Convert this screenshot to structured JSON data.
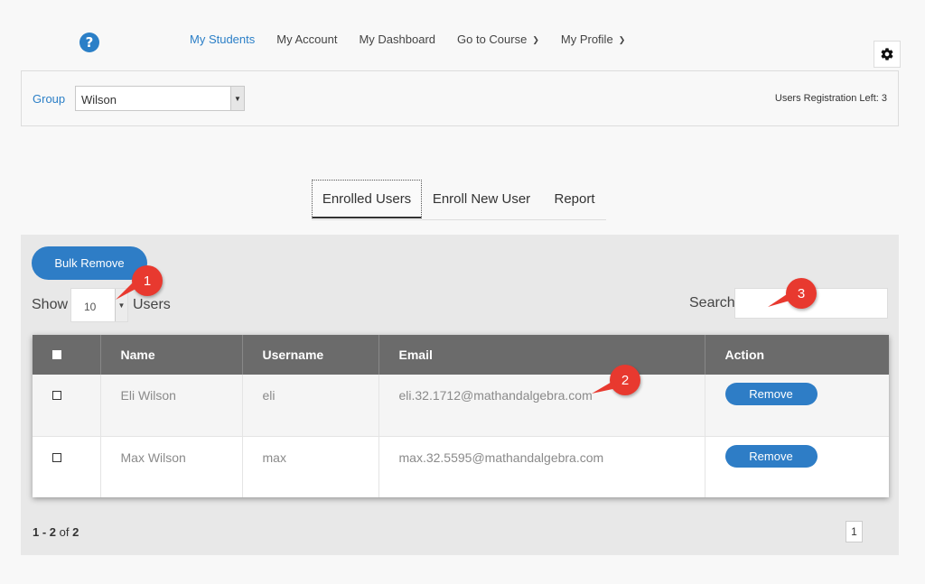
{
  "nav": {
    "items": [
      {
        "label": "My Students",
        "active": true,
        "dropdown": false
      },
      {
        "label": "My Account",
        "active": false,
        "dropdown": false
      },
      {
        "label": "My Dashboard",
        "active": false,
        "dropdown": false
      },
      {
        "label": "Go to Course",
        "active": false,
        "dropdown": true
      },
      {
        "label": "My Profile",
        "active": false,
        "dropdown": true
      }
    ],
    "help_icon": "?"
  },
  "group": {
    "label": "Group",
    "selected": "Wilson",
    "registration_left": "Users Registration Left: 3"
  },
  "tabs": {
    "enrolled": "Enrolled Users",
    "enroll_new": "Enroll New User",
    "report": "Report"
  },
  "controls": {
    "bulk_remove": "Bulk Remove",
    "show_label": "Show",
    "show_value": "10",
    "users_label": "Users",
    "search_label": "Search"
  },
  "table": {
    "headers": {
      "name": "Name",
      "username": "Username",
      "email": "Email",
      "action": "Action"
    },
    "rows": [
      {
        "name": "Eli Wilson",
        "username": "eli",
        "email": "eli.32.1712@mathandalgebra.com",
        "action": "Remove"
      },
      {
        "name": "Max Wilson",
        "username": "max",
        "email": "max.32.5595@mathandalgebra.com",
        "action": "Remove"
      }
    ]
  },
  "pagination": {
    "range": "1 - 2",
    "of": "of",
    "total": "2",
    "page": "1"
  },
  "callouts": {
    "one": "1",
    "two": "2",
    "three": "3"
  },
  "colors": {
    "accent": "#2b7fc7",
    "button": "#2e7dc6",
    "callout": "#e8392f",
    "header": "#6b6b6b"
  }
}
